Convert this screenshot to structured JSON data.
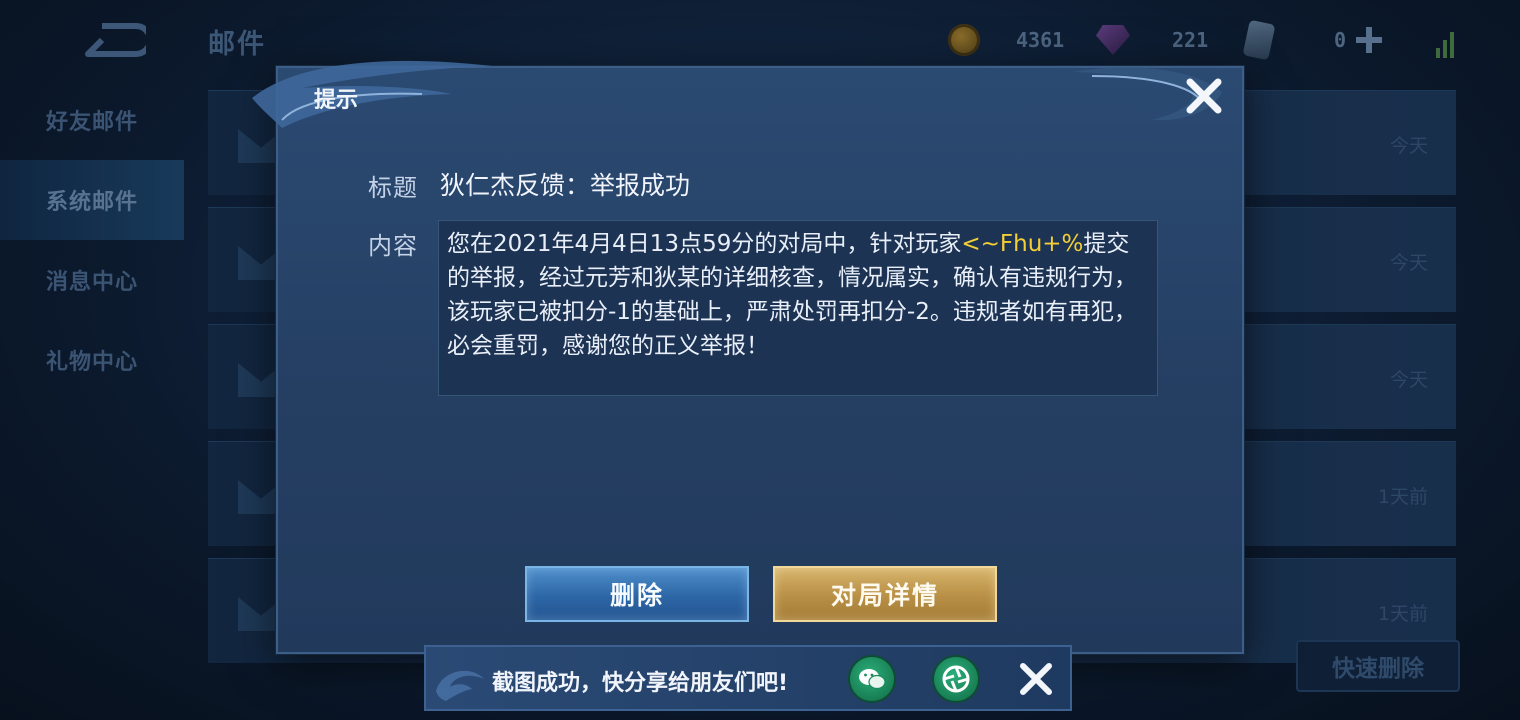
{
  "header": {
    "title": "邮件",
    "gold": "4361",
    "gems": "221",
    "tickets": "0"
  },
  "sidebar": {
    "items": [
      {
        "label": "好友邮件"
      },
      {
        "label": "系统邮件"
      },
      {
        "label": "消息中心"
      },
      {
        "label": "礼物中心"
      }
    ]
  },
  "mail_list": {
    "times": [
      "今天",
      "今天",
      "今天",
      "1天前",
      "1天前"
    ],
    "quick_delete_label": "快速删除"
  },
  "dialog": {
    "title": "提示",
    "subject_label": "标题",
    "subject": "狄仁杰反馈：举报成功",
    "content_label": "内容",
    "content_before": "您在2021年4月4日13点59分的对局中，针对玩家",
    "content_player": "<~Fhu+%",
    "content_after": "提交的举报，经过元芳和狄某的详细核查，情况属实，确认有违规行为，该玩家已被扣分-1的基础上，严肃处罚再扣分-2。违规者如有再犯，必会重罚，感谢您的正义举报！",
    "delete_label": "删除",
    "detail_label": "对局详情"
  },
  "toast": {
    "message": "截图成功，快分享给朋友们吧!"
  },
  "colors": {
    "highlight": "#f3cf35",
    "delete_button": "#2d66a6",
    "detail_button": "#b88f45"
  }
}
